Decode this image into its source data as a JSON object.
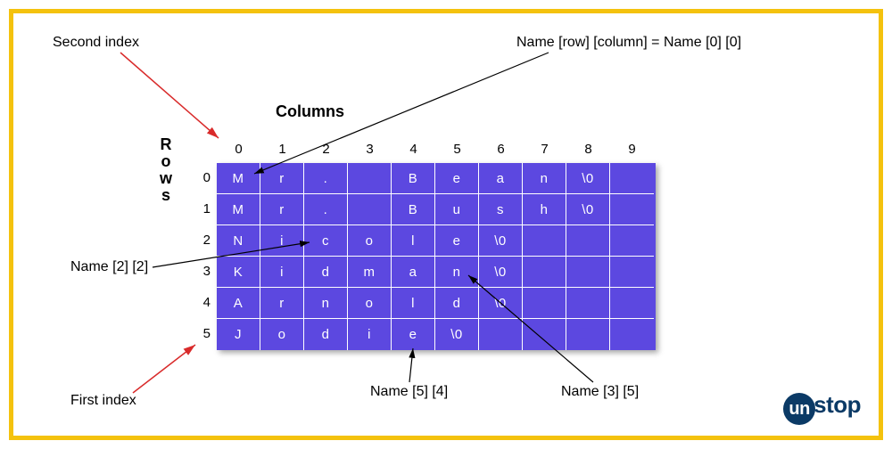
{
  "labels": {
    "second_index": "Second index",
    "first_index": "First index",
    "columns_heading": "Columns",
    "rows_heading": "Rows",
    "name_0_0": "Name [row] [column] = Name [0] [0]",
    "name_2_2": "Name [2] [2]",
    "name_5_4": "Name [5] [4]",
    "name_3_5": "Name [3] [5]"
  },
  "column_indices": [
    "0",
    "1",
    "2",
    "3",
    "4",
    "5",
    "6",
    "7",
    "8",
    "9"
  ],
  "row_indices": [
    "0",
    "1",
    "2",
    "3",
    "4",
    "5"
  ],
  "grid": [
    [
      "M",
      "r",
      ".",
      " ",
      "B",
      "e",
      "a",
      "n",
      "\\0",
      ""
    ],
    [
      "M",
      "r",
      ".",
      " ",
      "B",
      "u",
      "s",
      "h",
      "\\0",
      ""
    ],
    [
      "N",
      "i",
      "c",
      "o",
      "l",
      "e",
      "\\0",
      "",
      "",
      ""
    ],
    [
      "K",
      "i",
      "d",
      "m",
      "a",
      "n",
      "\\0",
      "",
      "",
      ""
    ],
    [
      "A",
      "r",
      "n",
      "o",
      "l",
      "d",
      "\\0",
      "",
      "",
      ""
    ],
    [
      "J",
      "o",
      "d",
      "i",
      "e",
      "\\0",
      "",
      "",
      "",
      ""
    ]
  ],
  "logo": {
    "prefix": "un",
    "suffix": "stop"
  },
  "colors": {
    "border": "#f4c20d",
    "cell_bg": "#5c48e0",
    "arrow_red": "#d92b2b",
    "arrow_black": "#000000",
    "logo": "#0b3a66"
  }
}
